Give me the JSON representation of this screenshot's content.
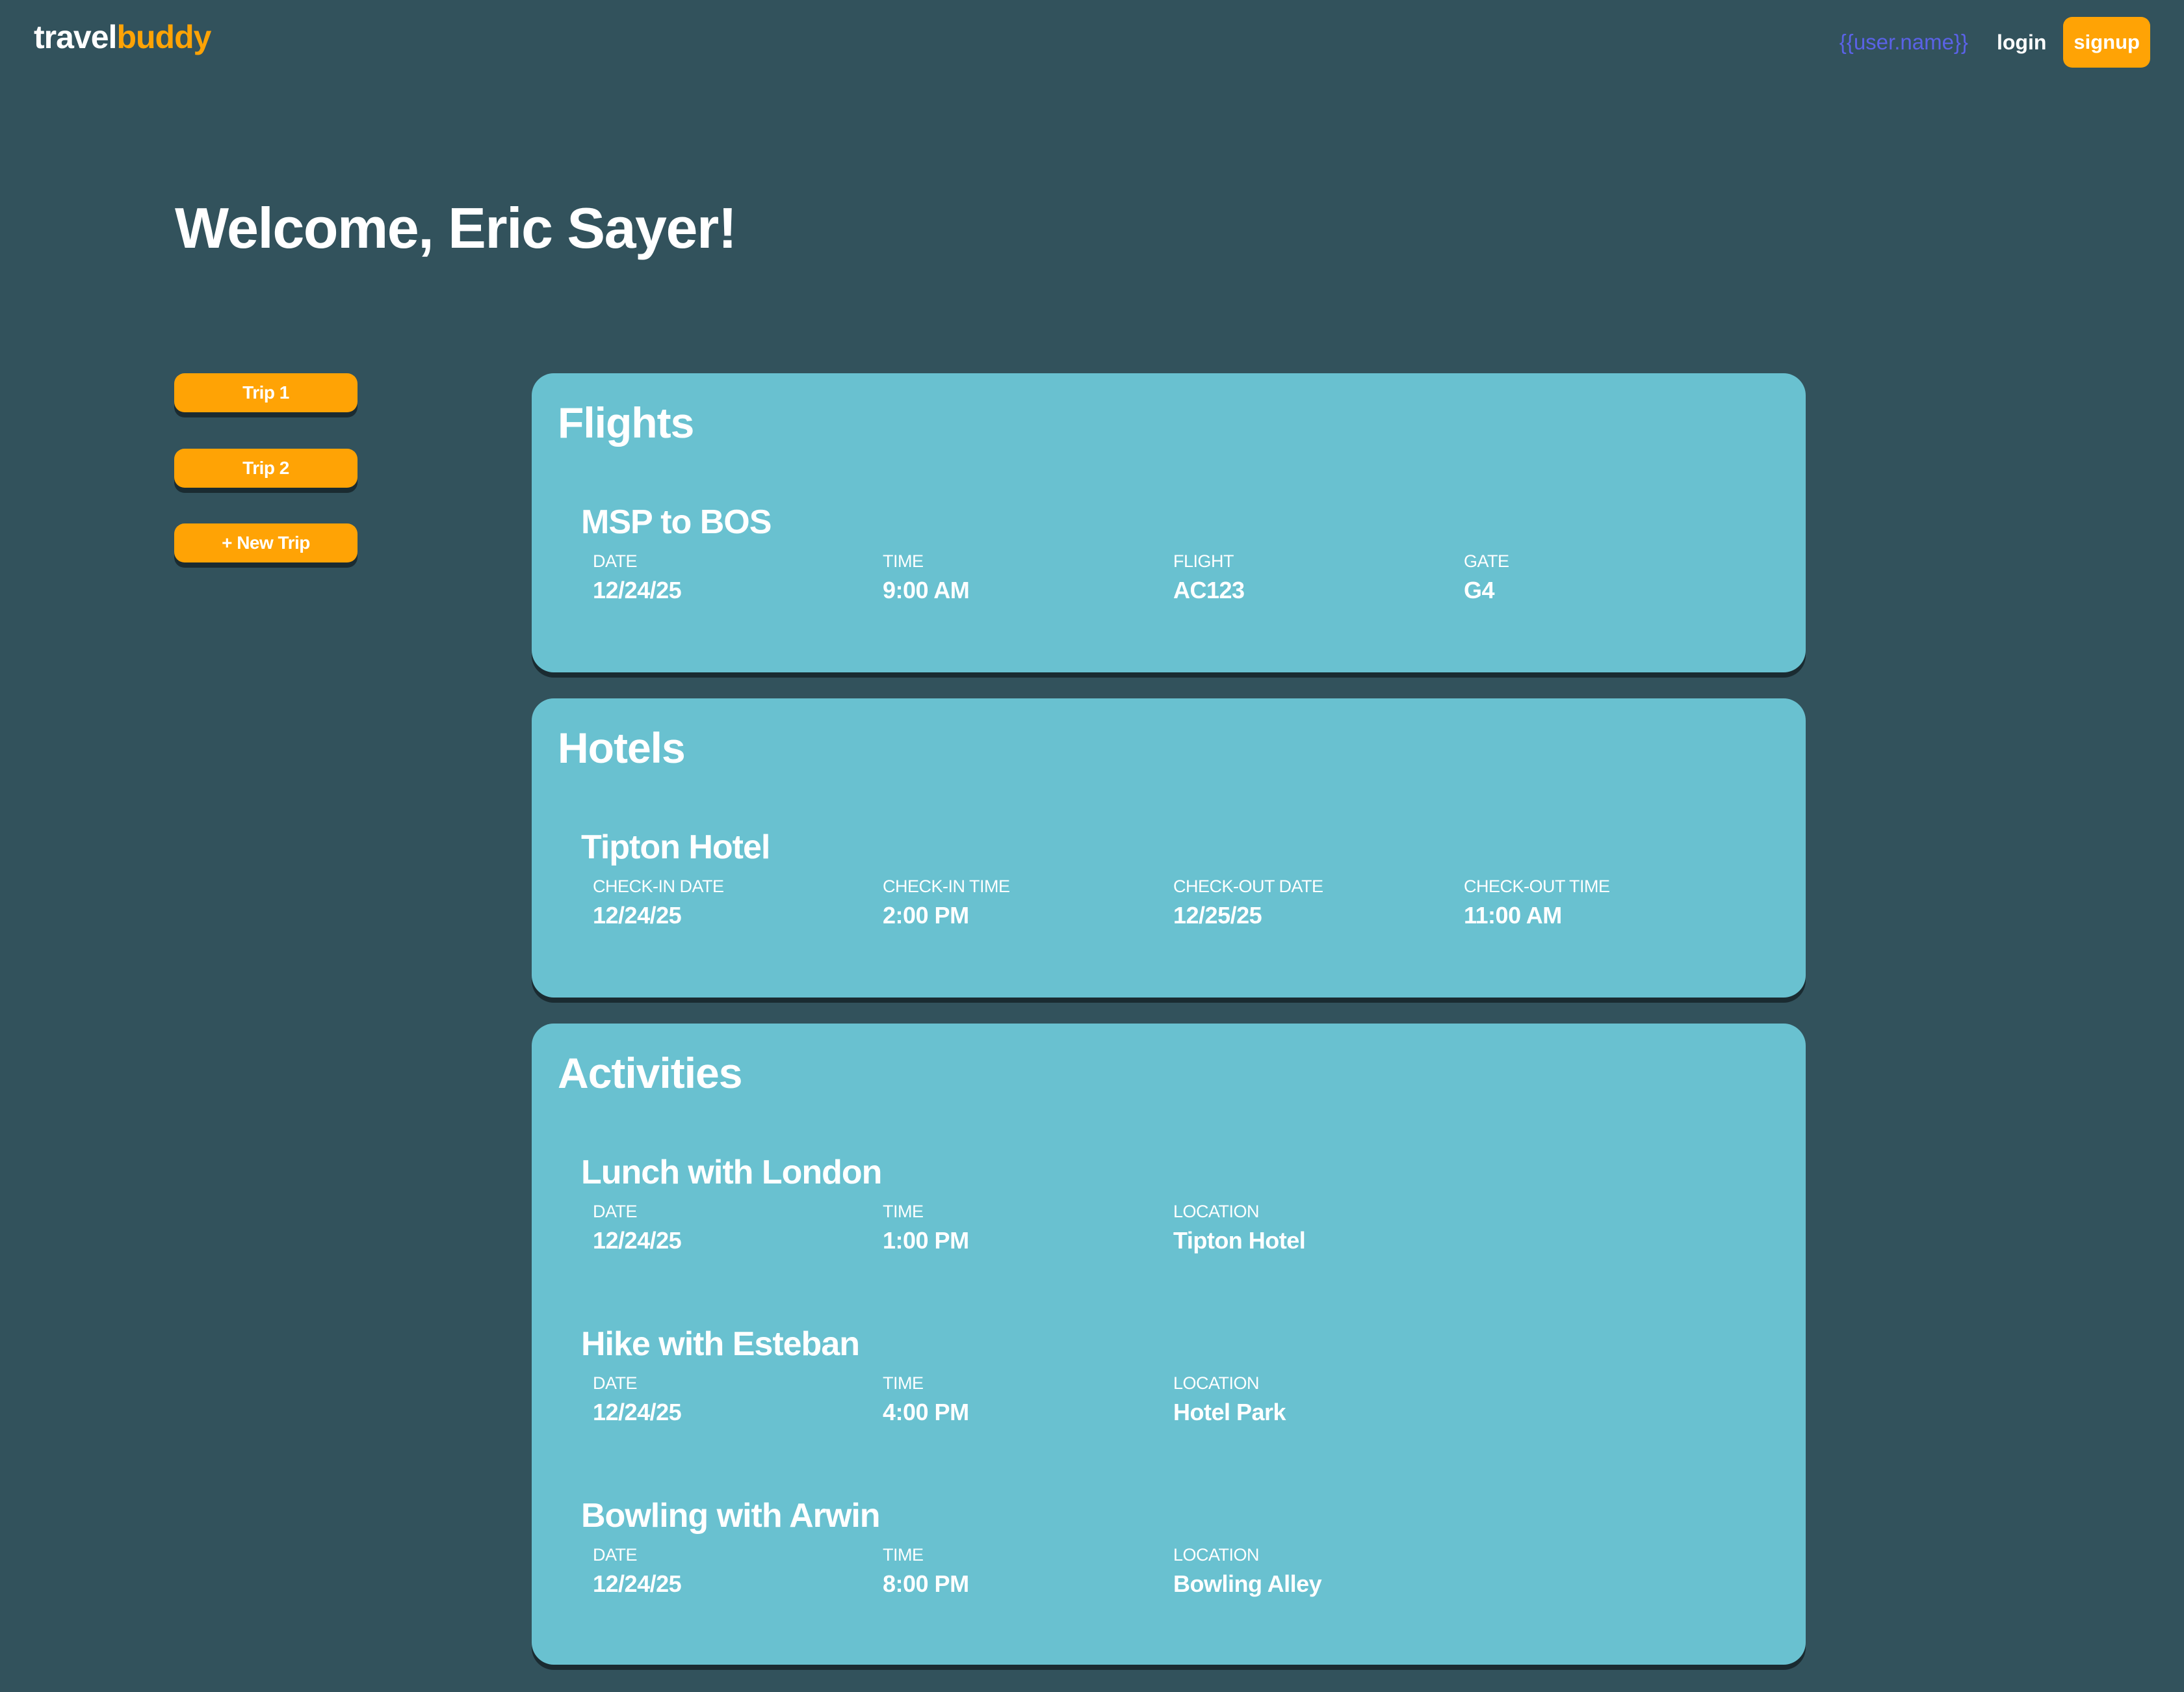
{
  "nav": {
    "logo_part1": "travel",
    "logo_part2": "buddy",
    "user_placeholder": "{{user.name}}",
    "login_label": "login",
    "signup_label": "signup"
  },
  "welcome": "Welcome, Eric Sayer!",
  "trips": [
    {
      "label": "Trip 1"
    },
    {
      "label": "Trip 2"
    },
    {
      "label": "+ New Trip"
    }
  ],
  "flights": {
    "title": "Flights",
    "items": [
      {
        "title": "MSP to BOS",
        "fields": [
          {
            "label": "DATE",
            "value": "12/24/25"
          },
          {
            "label": "TIME",
            "value": "9:00 AM"
          },
          {
            "label": "FLIGHT",
            "value": "AC123"
          },
          {
            "label": "GATE",
            "value": "G4"
          }
        ]
      }
    ]
  },
  "hotels": {
    "title": "Hotels",
    "items": [
      {
        "title": "Tipton Hotel",
        "fields": [
          {
            "label": "CHECK-IN DATE",
            "value": "12/24/25"
          },
          {
            "label": "CHECK-IN TIME",
            "value": "2:00 PM"
          },
          {
            "label": "CHECK-OUT DATE",
            "value": "12/25/25"
          },
          {
            "label": "CHECK-OUT TIME",
            "value": "11:00 AM"
          }
        ]
      }
    ]
  },
  "activities": {
    "title": "Activities",
    "items": [
      {
        "title": "Lunch with London",
        "fields": [
          {
            "label": "DATE",
            "value": "12/24/25"
          },
          {
            "label": "TIME",
            "value": "1:00 PM"
          },
          {
            "label": "LOCATION",
            "value": "Tipton Hotel"
          }
        ]
      },
      {
        "title": "Hike with Esteban",
        "fields": [
          {
            "label": "DATE",
            "value": "12/24/25"
          },
          {
            "label": "TIME",
            "value": "4:00 PM"
          },
          {
            "label": "LOCATION",
            "value": "Hotel Park"
          }
        ]
      },
      {
        "title": "Bowling with Arwin",
        "fields": [
          {
            "label": "DATE",
            "value": "12/24/25"
          },
          {
            "label": "TIME",
            "value": "8:00 PM"
          },
          {
            "label": "LOCATION",
            "value": "Bowling Alley"
          }
        ]
      }
    ]
  },
  "colors": {
    "background": "#32525c",
    "card": "#69c1d0",
    "accent": "#ffa305",
    "user_link": "#5a62e6"
  }
}
